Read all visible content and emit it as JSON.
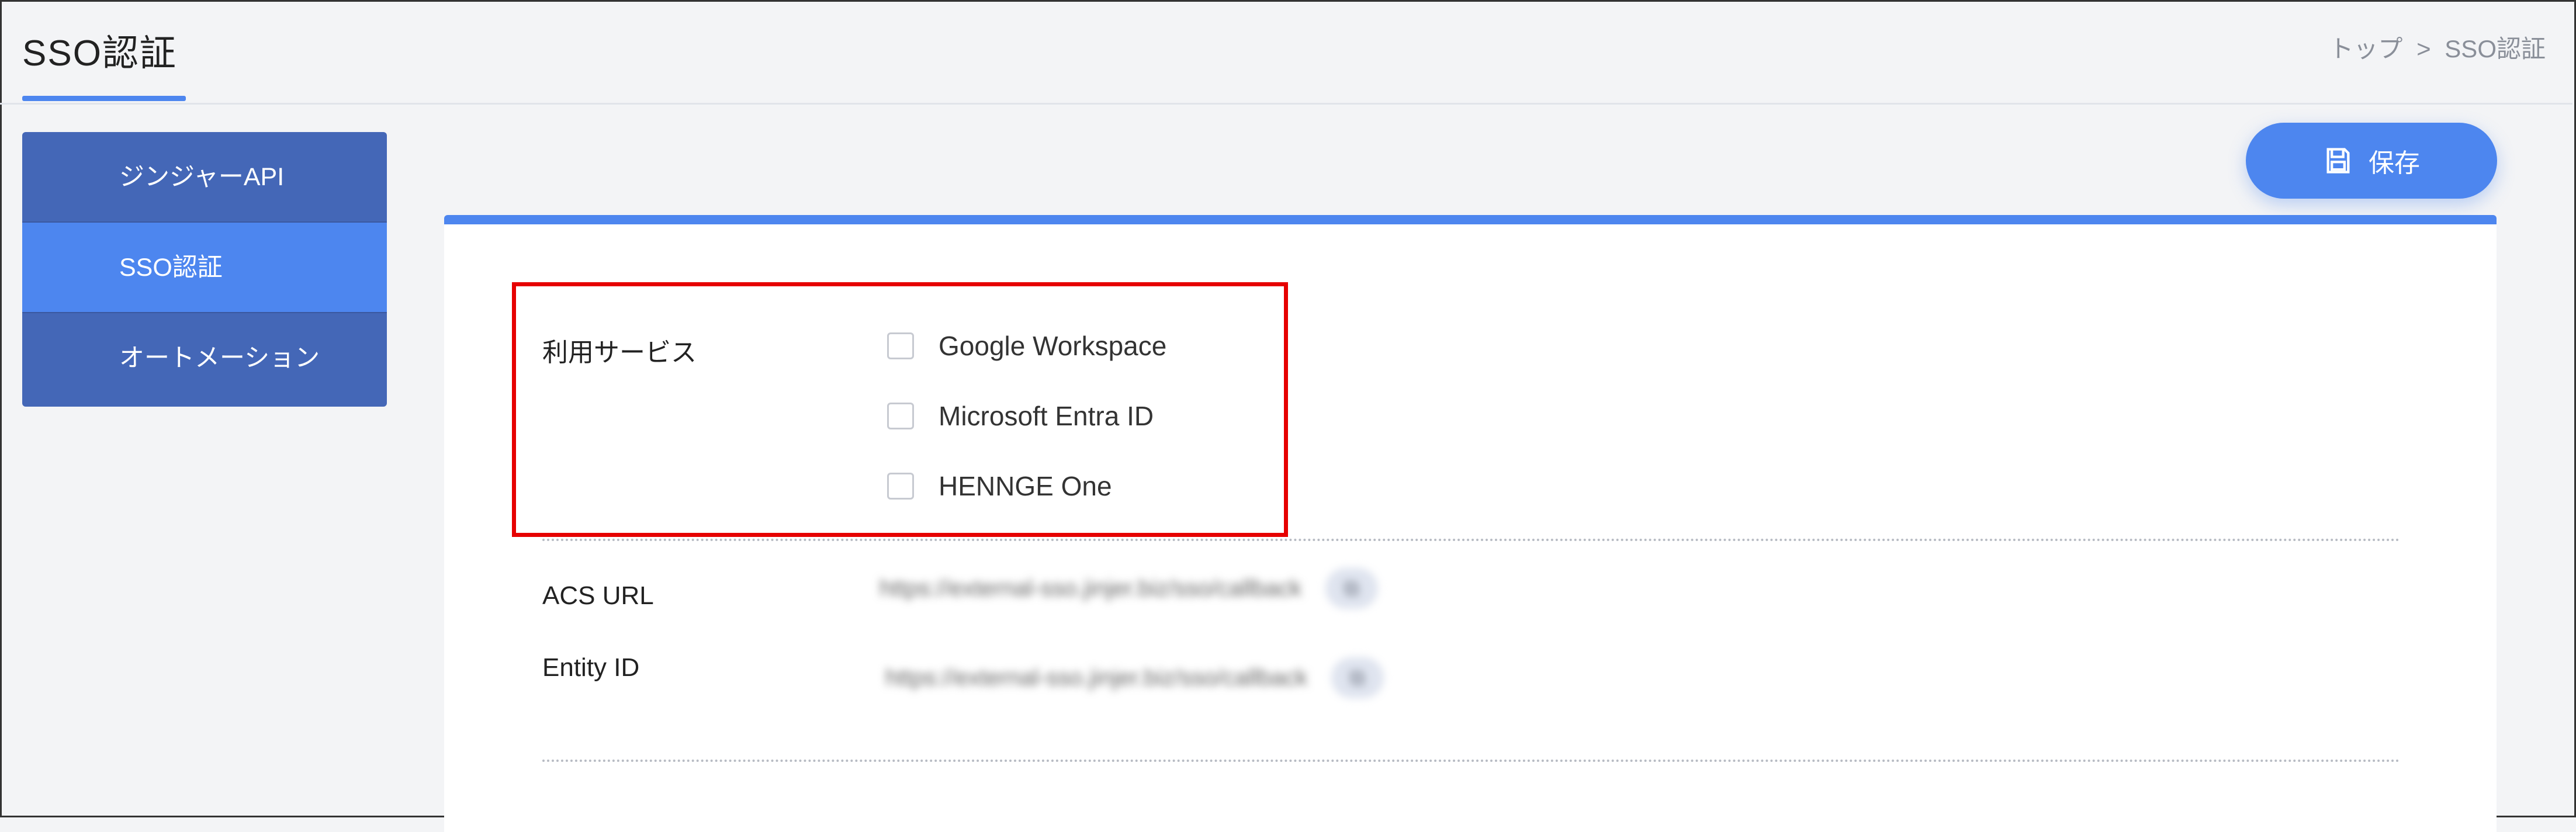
{
  "header": {
    "title": "SSO認証",
    "breadcrumb": {
      "home": "トップ",
      "separator": ">",
      "current": "SSO認証"
    }
  },
  "sidebar": {
    "items": [
      {
        "label": "ジンジャーAPI",
        "active": false
      },
      {
        "label": "SSO認証",
        "active": true
      },
      {
        "label": "オートメーション",
        "active": false
      }
    ]
  },
  "toolbar": {
    "save_label": "保存",
    "save_icon": "save-icon"
  },
  "form": {
    "services_label": "利用サービス",
    "services": [
      {
        "label": "Google Workspace",
        "checked": false
      },
      {
        "label": "Microsoft Entra ID",
        "checked": false
      },
      {
        "label": "HENNGE One",
        "checked": false
      }
    ],
    "acs_url_label": "ACS URL",
    "acs_url_value": "https://external-sso.jinjer.biz/sso/callback",
    "entity_id_label": "Entity ID",
    "entity_id_value": "https://external-sso.jinjer.biz/sso/callback",
    "copy_icon": "copy-icon"
  },
  "colors": {
    "accent": "#4d86ef",
    "sidebar": "#4467b7",
    "highlight": "#e60000"
  }
}
